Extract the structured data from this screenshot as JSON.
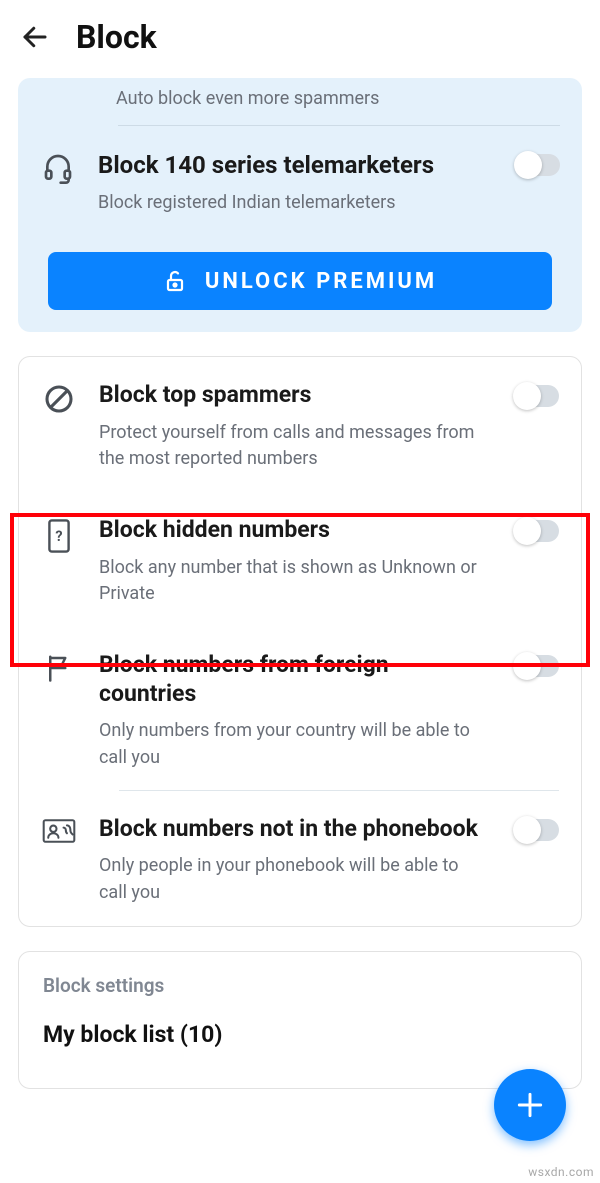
{
  "header": {
    "title": "Block"
  },
  "premium": {
    "auto_block_sub": "Auto block even more spammers",
    "telemarketers": {
      "title": "Block 140 series telemarketers",
      "sub": "Block registered Indian telemarketers"
    },
    "unlock_label": "UNLOCK PREMIUM"
  },
  "settings": {
    "top_spammers": {
      "title": "Block top spammers",
      "sub": "Protect yourself from calls and messages from the most reported numbers"
    },
    "hidden": {
      "title": "Block hidden numbers",
      "sub": "Block any number that is shown as Unknown or Private"
    },
    "foreign": {
      "title": "Block numbers from foreign countries",
      "sub": "Only numbers from your country will be able to call you"
    },
    "phonebook": {
      "title": "Block numbers not in the phonebook",
      "sub": "Only people in your phonebook will be able to call you"
    }
  },
  "block_list": {
    "section_label": "Block settings",
    "title": "My block list (10)"
  },
  "watermark": "wsxdn.com"
}
